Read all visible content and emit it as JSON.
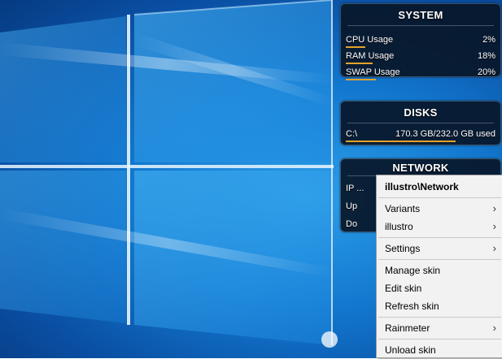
{
  "system": {
    "title": "SYSTEM",
    "rows": [
      {
        "label": "CPU Usage",
        "value": "2%",
        "fraction": 0.02
      },
      {
        "label": "RAM Usage",
        "value": "18%",
        "fraction": 0.18
      },
      {
        "label": "SWAP Usage",
        "value": "20%",
        "fraction": 0.2
      }
    ]
  },
  "disks": {
    "title": "DISKS",
    "rows": [
      {
        "label": "C:\\",
        "value": "170.3 GB/232.0 GB used",
        "fraction": 0.734
      }
    ]
  },
  "network": {
    "title": "NETWORK",
    "rows": [
      {
        "label": "IP ..."
      },
      {
        "label": "Up"
      },
      {
        "label": "Do"
      }
    ]
  },
  "context_menu": {
    "header": "illustro\\Network",
    "items": [
      {
        "label": "Variants",
        "submenu": true
      },
      {
        "label": "illustro",
        "submenu": true
      },
      {
        "label": "Settings",
        "submenu": true
      },
      {
        "label": "Manage skin",
        "submenu": false
      },
      {
        "label": "Edit skin",
        "submenu": false
      },
      {
        "label": "Refresh skin",
        "submenu": false
      },
      {
        "label": "Rainmeter",
        "submenu": true
      },
      {
        "label": "Unload skin",
        "submenu": false
      }
    ],
    "chevron_glyph": "›"
  },
  "colors": {
    "accent_bar": "#e3a22a",
    "skin_bg": "#081628",
    "menu_bg": "#f2f2f2"
  }
}
